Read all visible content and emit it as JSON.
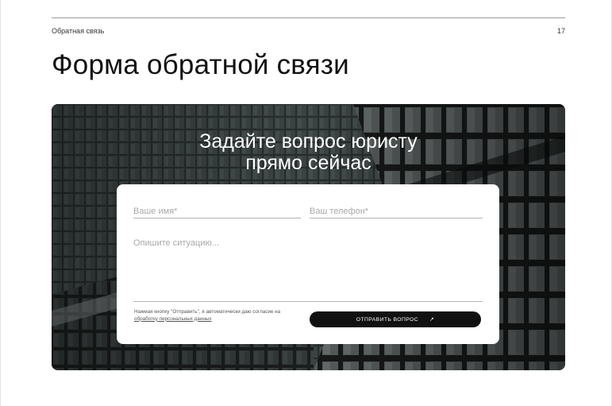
{
  "header": {
    "section_label": "Обратная связь",
    "page_number": "17"
  },
  "page_title": "Форма обратной связи",
  "hero": {
    "heading_line1": "Задайте вопрос юристу",
    "heading_line2": "прямо сейчас"
  },
  "form": {
    "name_placeholder": "Ваше имя*",
    "phone_placeholder": "Ваш телефон*",
    "situation_placeholder": "Опишите ситуацию...",
    "consent_text": "Нажмая кнопку \"Отправить\", я автоматически даю согласие на",
    "consent_link": "обработку персональных данных",
    "submit_label": "ОТПРАВИТЬ ВОПРОС",
    "submit_icon": "arrow-up-right-icon"
  },
  "colors": {
    "button_bg": "#111111",
    "card_bg": "#ffffff",
    "hero_dark": "#1f2424"
  }
}
